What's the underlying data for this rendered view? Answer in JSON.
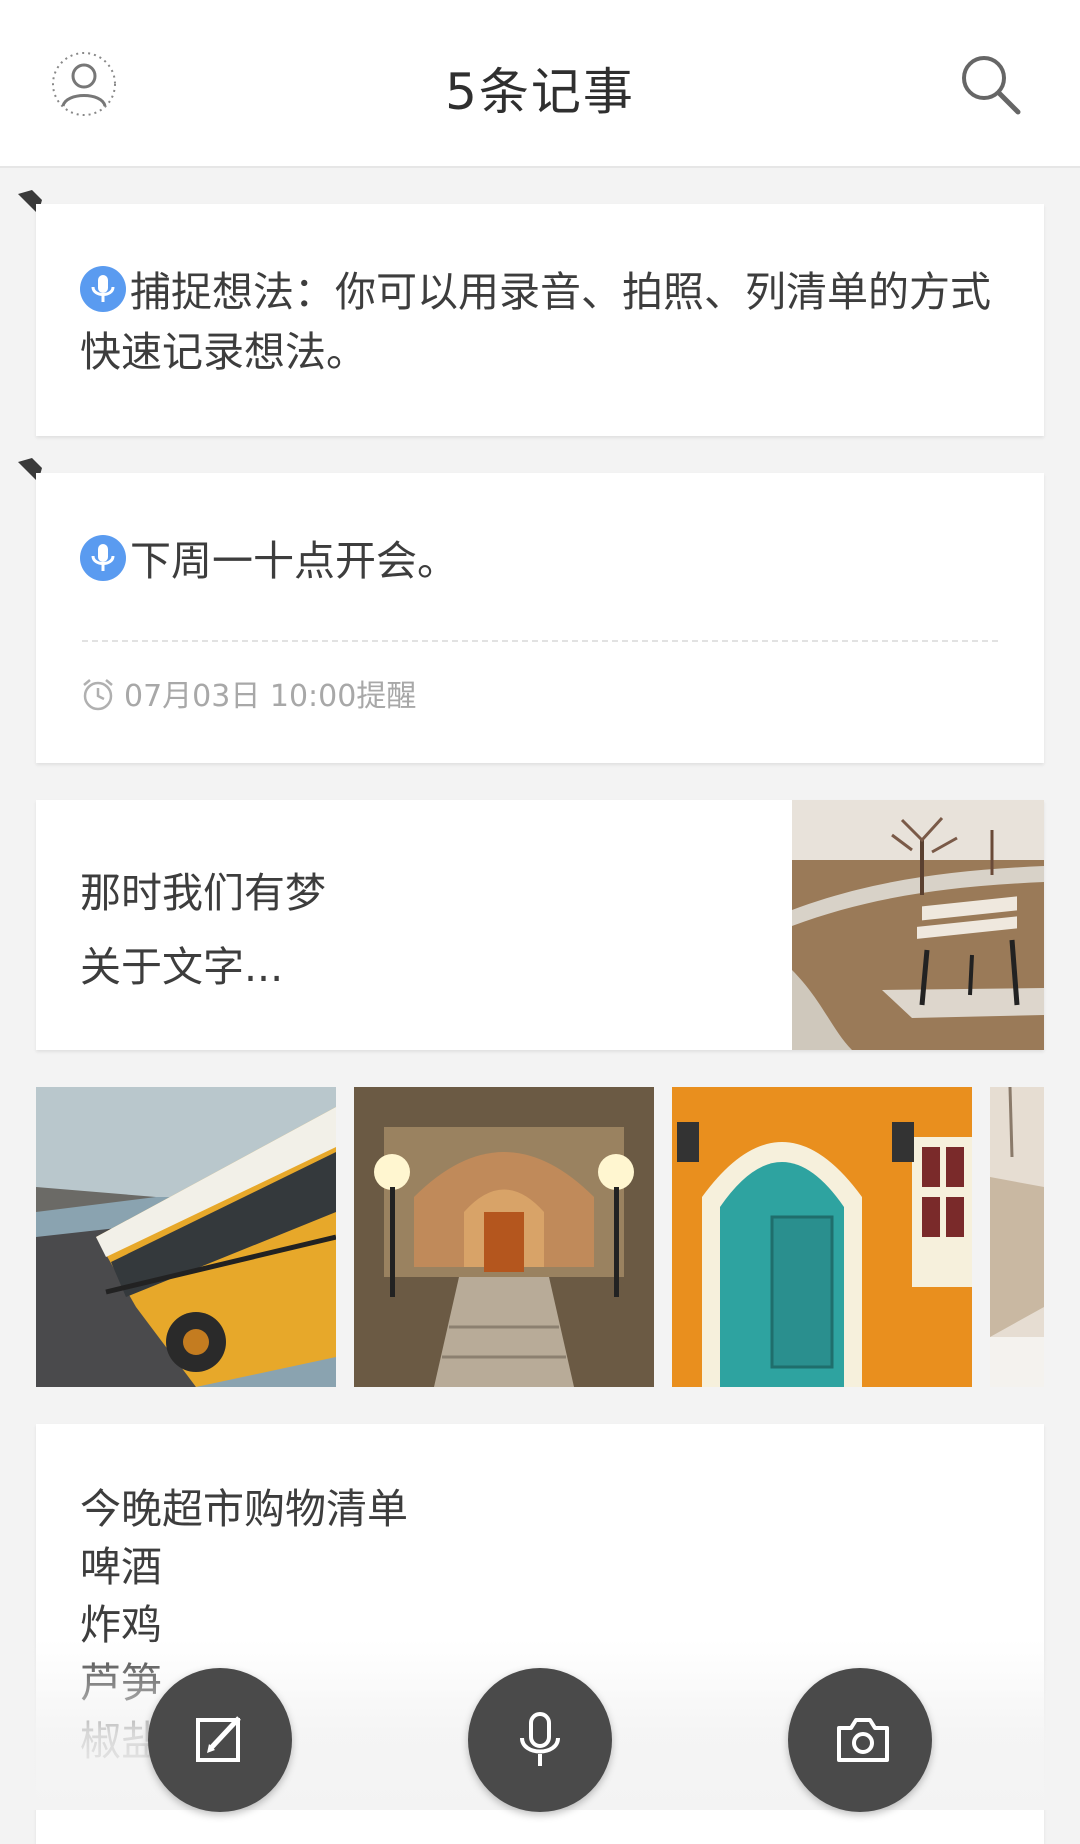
{
  "header": {
    "title": "5条记事",
    "avatar_icon": "avatar-icon",
    "search_icon": "search-icon"
  },
  "notes": [
    {
      "type": "voice",
      "pinned": true,
      "text": "捕捉想法：你可以用录音、拍照、列清单的方式快速记录想法。"
    },
    {
      "type": "voice",
      "pinned": true,
      "text": "下周一十点开会。",
      "reminder": "07月03日  10:00提醒"
    },
    {
      "type": "text-image",
      "title": "那时我们有梦",
      "preview": "关于文字..."
    },
    {
      "type": "gallery",
      "images": [
        "bus",
        "castle-stairs",
        "blue-door",
        "snowy-bench"
      ]
    },
    {
      "type": "checklist",
      "lines": [
        "今晚超市购物清单",
        "啤酒",
        "炸鸡",
        "芦笋",
        "椒盐"
      ]
    }
  ],
  "fabs": {
    "edit_icon": "edit-icon",
    "mic_icon": "microphone-icon",
    "camera_icon": "camera-icon"
  },
  "colors": {
    "accent_blue": "#5a9bf0",
    "fab_bg": "#4a4a4a",
    "background": "#f3f3f3"
  }
}
